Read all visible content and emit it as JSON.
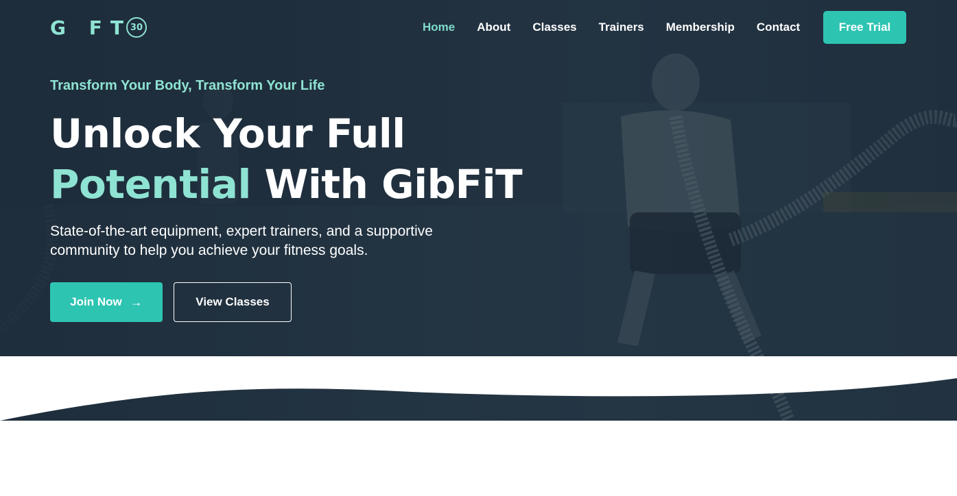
{
  "brand": {
    "logo_text": "G FT",
    "logo_badge": "30",
    "accent_color": "#2ec4b2",
    "highlight_color": "#8fe3d3"
  },
  "nav": {
    "items": [
      {
        "label": "Home",
        "active": true
      },
      {
        "label": "About"
      },
      {
        "label": "Classes"
      },
      {
        "label": "Trainers"
      },
      {
        "label": "Membership"
      },
      {
        "label": "Contact"
      }
    ],
    "cta_label": "Free Trial"
  },
  "hero": {
    "tagline": "Transform Your Body, Transform Your Life",
    "headline_line1": "Unlock Your Full",
    "headline_accent": "Potential",
    "headline_rest": "With GibFiT",
    "subtext": "State-of-the-art equipment, expert trainers, and a supportive community to help you achieve your fitness goals.",
    "primary_button": "Join Now",
    "primary_button_icon": "arrow-right-icon",
    "secondary_button": "View Classes"
  }
}
